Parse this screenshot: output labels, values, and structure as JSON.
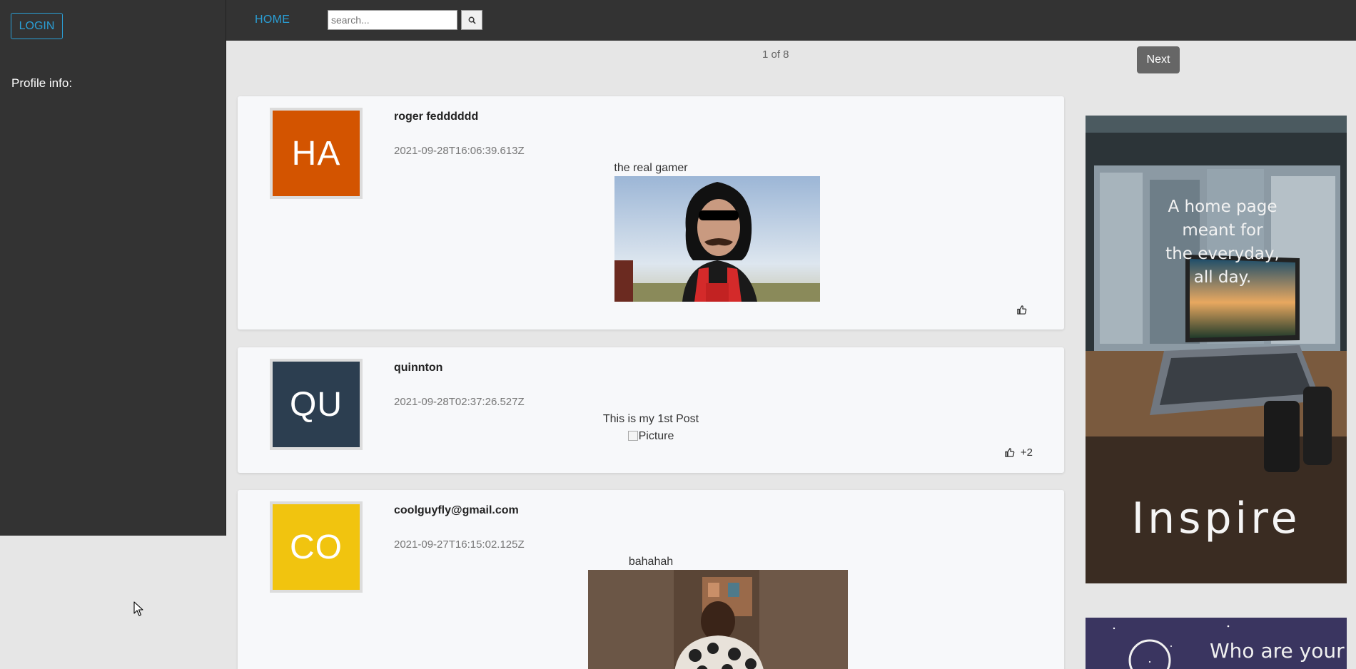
{
  "sidebar": {
    "login_label": "LOGIN",
    "profile_label": "Profile info:"
  },
  "nav": {
    "home_label": "HOME",
    "search_placeholder": "search...",
    "search_icon": "search-icon"
  },
  "pagination": {
    "status": "1 of 8",
    "next_label": "Next"
  },
  "posts": [
    {
      "initials": "HA",
      "avatar_color": "#d35400",
      "author": "roger fedddddd",
      "timestamp": "2021-09-28T16:06:39.613Z",
      "content": "the real gamer",
      "like_count": ""
    },
    {
      "initials": "QU",
      "avatar_color": "#2c3e50",
      "author": "quinnton",
      "timestamp": "2021-09-28T02:37:26.527Z",
      "content": "This is my 1st Post",
      "image_alt": "Picture",
      "like_count": "+2"
    },
    {
      "initials": "CO",
      "avatar_color": "#f1c40f",
      "author": "coolguyfly@gmail.com",
      "timestamp": "2021-09-27T16:15:02.125Z",
      "content": "bahahah",
      "like_count": ""
    }
  ],
  "ads": [
    {
      "tagline": [
        "A home page",
        "meant for",
        "the everyday,",
        "all day."
      ],
      "title": "Inspire"
    },
    {
      "tagline": [
        "Who are your"
      ]
    }
  ],
  "colors": {
    "accent": "#2a9fd6",
    "dark_bg": "#333333",
    "page_bg": "#e6e6e6",
    "card_bg": "#f7f8fa"
  }
}
